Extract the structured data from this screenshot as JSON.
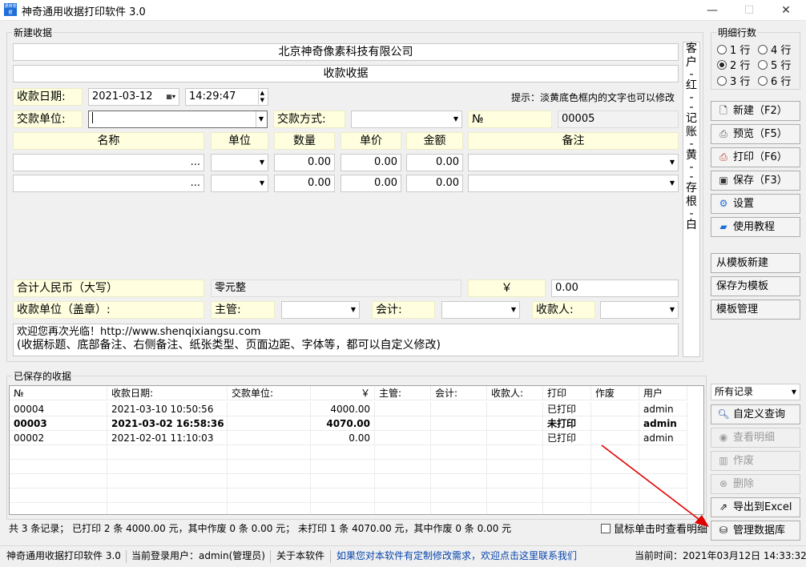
{
  "window": {
    "title": "神奇通用收据打印软件 3.0",
    "logo_text": "通用收据",
    "minimize": "—",
    "maximize": "☐",
    "close": "✕"
  },
  "receipt": {
    "group_label": "新建收据",
    "company": "北京神奇像素科技有限公司",
    "title": "收款收据",
    "date_label": "收款日期:",
    "date": "2021-03-12",
    "time": "14:29:47",
    "hint": "提示：淡黄底色框内的文字也可以修改",
    "payer_label": "交款单位:",
    "payer": "",
    "method_label": "交款方式:",
    "method": "",
    "no_label": "№",
    "no": "00005",
    "headers": {
      "name": "名称",
      "unit": "单位",
      "qty": "数量",
      "price": "单价",
      "amount": "金额",
      "remark": "备注"
    },
    "items": [
      {
        "name": "...",
        "unit": "",
        "qty": "0.00",
        "price": "0.00",
        "amount": "0.00",
        "remark": ""
      },
      {
        "name": "...",
        "unit": "",
        "qty": "0.00",
        "price": "0.00",
        "amount": "0.00",
        "remark": ""
      }
    ],
    "total_label": "合计人民币（大写）",
    "total_words": "零元整",
    "currency": "￥",
    "total_amount": "0.00",
    "stamp_label": "收款单位（盖章）:",
    "supervisor_label": "主管:",
    "accountant_label": "会计:",
    "cashier_label": "收款人:",
    "footer_note_1": "欢迎您再次光临！http://www.shenqixiangsu.com",
    "footer_note_2": "(收据标题、底部备注、右侧备注、纸张类型、页面边距、字体等，都可以自定义修改)",
    "side_note": [
      "客",
      "户",
      "-",
      "红",
      "-",
      "-",
      "记",
      "账",
      "-",
      "黄",
      "-",
      "-",
      "存",
      "根",
      "-",
      "白"
    ]
  },
  "detail_rows": {
    "group_label": "明细行数",
    "options": [
      {
        "label": "1 行",
        "checked": false
      },
      {
        "label": "4 行",
        "checked": false
      },
      {
        "label": "2 行",
        "checked": true
      },
      {
        "label": "5 行",
        "checked": false
      },
      {
        "label": "3 行",
        "checked": false
      },
      {
        "label": "6 行",
        "checked": false
      }
    ]
  },
  "actions": {
    "new": "新建（F2）",
    "preview": "预览（F5）",
    "print": "打印（F6）",
    "save": "保存（F3）",
    "settings": "设置",
    "tutorial": "使用教程",
    "from_template": "从模板新建",
    "save_template": "保存为模板",
    "manage_template": "模板管理"
  },
  "saved": {
    "group_label": "已保存的收据",
    "filter": "所有记录",
    "columns": [
      "№",
      "收款日期:",
      "交款单位:",
      "￥",
      "主管:",
      "会计:",
      "收款人:",
      "打印",
      "作废",
      "用户"
    ],
    "rows": [
      {
        "no": "00004",
        "date": "2021-03-10 10:50:56",
        "payer": "",
        "amount": "4000.00",
        "sup": "",
        "acc": "",
        "cashier": "",
        "print": "已打印",
        "void": "",
        "user": "admin",
        "bold": false
      },
      {
        "no": "00003",
        "date": "2021-03-02 16:58:36",
        "payer": "",
        "amount": "4070.00",
        "sup": "",
        "acc": "",
        "cashier": "",
        "print": "未打印",
        "void": "",
        "user": "admin",
        "bold": true
      },
      {
        "no": "00002",
        "date": "2021-02-01 11:10:03",
        "payer": "",
        "amount": "0.00",
        "sup": "",
        "acc": "",
        "cashier": "",
        "print": "已打印",
        "void": "",
        "user": "admin",
        "bold": false
      }
    ],
    "summary": "共 3 条记录；   已打印 2 条 4000.00 元，其中作废 0 条 0.00 元；   未打印 1 条 4070.00 元，其中作废 0 条 0.00 元",
    "click_detail": "鼠标单击时查看明细",
    "buttons": {
      "custom_query": "自定义查询",
      "view_detail": "查看明细",
      "void": "作废",
      "delete": "删除",
      "export": "导出到Excel",
      "manage_db": "管理数据库"
    }
  },
  "status": {
    "app": "神奇通用收据打印软件 3.0",
    "user": "当前登录用户：admin(管理员)",
    "about": "关于本软件",
    "custom": "如果您对本软件有定制修改需求，欢迎点击这里联系我们",
    "time": "当前时间：2021年03月12日 14:33:32"
  },
  "colors": {
    "accent_link": "#0645ad",
    "label_bg": "#ffffe0",
    "annotation": "#e00000"
  }
}
